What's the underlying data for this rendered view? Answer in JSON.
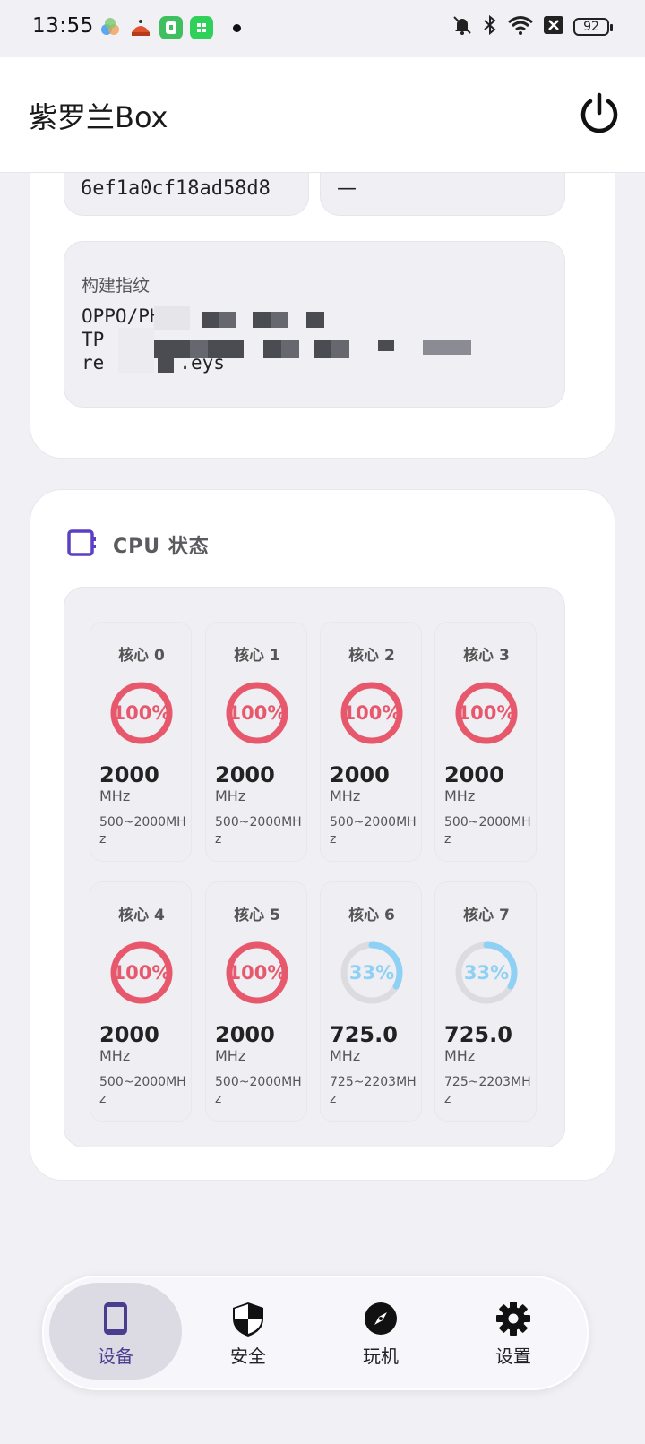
{
  "status_bar": {
    "time": "13:55",
    "battery": "92",
    "icons": [
      "app-notification-icon",
      "mute-icon",
      "bluetooth-icon",
      "wifi-icon",
      "data-off-icon"
    ]
  },
  "app": {
    "title": "紫罗兰Box"
  },
  "device_info": {
    "top_left_value": "6ef1a0cf18ad58d8",
    "top_right_value": "—",
    "fingerprint_label": "构建指纹",
    "fingerprint_lines": [
      "OPPO/PH",
      "TP",
      "re",
      ".eys"
    ]
  },
  "cpu": {
    "title": "CPU 状态",
    "cores": [
      {
        "name": "核心 0",
        "usage": "100%",
        "usage_value": 1.0,
        "freq": "2000",
        "unit": "MHz",
        "range": "500~2000MHz"
      },
      {
        "name": "核心 1",
        "usage": "100%",
        "usage_value": 1.0,
        "freq": "2000",
        "unit": "MHz",
        "range": "500~2000MHz"
      },
      {
        "name": "核心 2",
        "usage": "100%",
        "usage_value": 1.0,
        "freq": "2000",
        "unit": "MHz",
        "range": "500~2000MHz"
      },
      {
        "name": "核心 3",
        "usage": "100%",
        "usage_value": 1.0,
        "freq": "2000",
        "unit": "MHz",
        "range": "500~2000MHz"
      },
      {
        "name": "核心 4",
        "usage": "100%",
        "usage_value": 1.0,
        "freq": "2000",
        "unit": "MHz",
        "range": "500~2000MHz"
      },
      {
        "name": "核心 5",
        "usage": "100%",
        "usage_value": 1.0,
        "freq": "2000",
        "unit": "MHz",
        "range": "500~2000MHz"
      },
      {
        "name": "核心 6",
        "usage": "33%",
        "usage_value": 0.33,
        "freq": "725.0",
        "unit": "MHz",
        "range": "725~2203MHz"
      },
      {
        "name": "核心 7",
        "usage": "33%",
        "usage_value": 0.33,
        "freq": "725.0",
        "unit": "MHz",
        "range": "725~2203MHz"
      }
    ]
  },
  "colors": {
    "high_usage": "#e8586d",
    "low_usage": "#8fd0f5",
    "ring_track": "#dcdce0",
    "accent": "#5b3fc4"
  },
  "nav": {
    "items": [
      {
        "label": "设备",
        "icon": "phone-icon",
        "active": true
      },
      {
        "label": "安全",
        "icon": "shield-icon",
        "active": false
      },
      {
        "label": "玩机",
        "icon": "compass-icon",
        "active": false
      },
      {
        "label": "设置",
        "icon": "gear-icon",
        "active": false
      }
    ]
  }
}
